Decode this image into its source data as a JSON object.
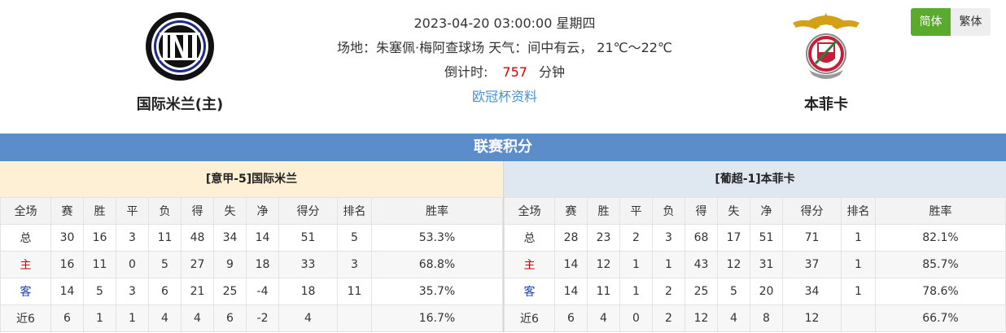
{
  "match": {
    "datetime": "2023-04-20 03:00:00 星期四",
    "venue_weather": "场地：朱塞佩·梅阿查球场 天气：间中有云， 21℃～22℃",
    "countdown_label": "倒计时:",
    "countdown_value": "757",
    "countdown_unit": "分钟",
    "info_link": "欧冠杯资料"
  },
  "home_team": {
    "name": "国际米兰(主)",
    "logo_icon": "inter-milan-crest-icon"
  },
  "away_team": {
    "name": "本菲卡",
    "logo_icon": "benfica-eagle-crest-icon"
  },
  "lang": {
    "simplified": "简体",
    "traditional": "繁体"
  },
  "section_title": "联赛积分",
  "columns": [
    "全场",
    "赛",
    "胜",
    "平",
    "负",
    "得",
    "失",
    "净",
    "得分",
    "排名",
    "胜率"
  ],
  "home_table": {
    "title": "[意甲-5]国际米兰",
    "rows": [
      [
        "总",
        "30",
        "16",
        "3",
        "11",
        "48",
        "34",
        "14",
        "51",
        "5",
        "53.3%"
      ],
      [
        "主",
        "16",
        "11",
        "0",
        "5",
        "27",
        "9",
        "18",
        "33",
        "3",
        "68.8%"
      ],
      [
        "客",
        "14",
        "5",
        "3",
        "6",
        "21",
        "25",
        "-4",
        "18",
        "11",
        "35.7%"
      ],
      [
        "近6",
        "6",
        "1",
        "1",
        "4",
        "4",
        "6",
        "-2",
        "4",
        "",
        "16.7%"
      ]
    ]
  },
  "away_table": {
    "title": "[葡超-1]本菲卡",
    "rows": [
      [
        "总",
        "28",
        "23",
        "2",
        "3",
        "68",
        "17",
        "51",
        "71",
        "1",
        "82.1%"
      ],
      [
        "主",
        "14",
        "12",
        "1",
        "1",
        "43",
        "12",
        "31",
        "37",
        "1",
        "85.7%"
      ],
      [
        "客",
        "14",
        "11",
        "1",
        "2",
        "25",
        "5",
        "20",
        "34",
        "1",
        "78.6%"
      ],
      [
        "近6",
        "6",
        "4",
        "0",
        "2",
        "12",
        "4",
        "8",
        "12",
        "",
        "66.7%"
      ]
    ]
  },
  "colors": {
    "section_bar": "#5b8dcb",
    "accent_red": "#d40000",
    "away_blue": "#1a3fb3",
    "lang_active": "#5aaa2e"
  }
}
